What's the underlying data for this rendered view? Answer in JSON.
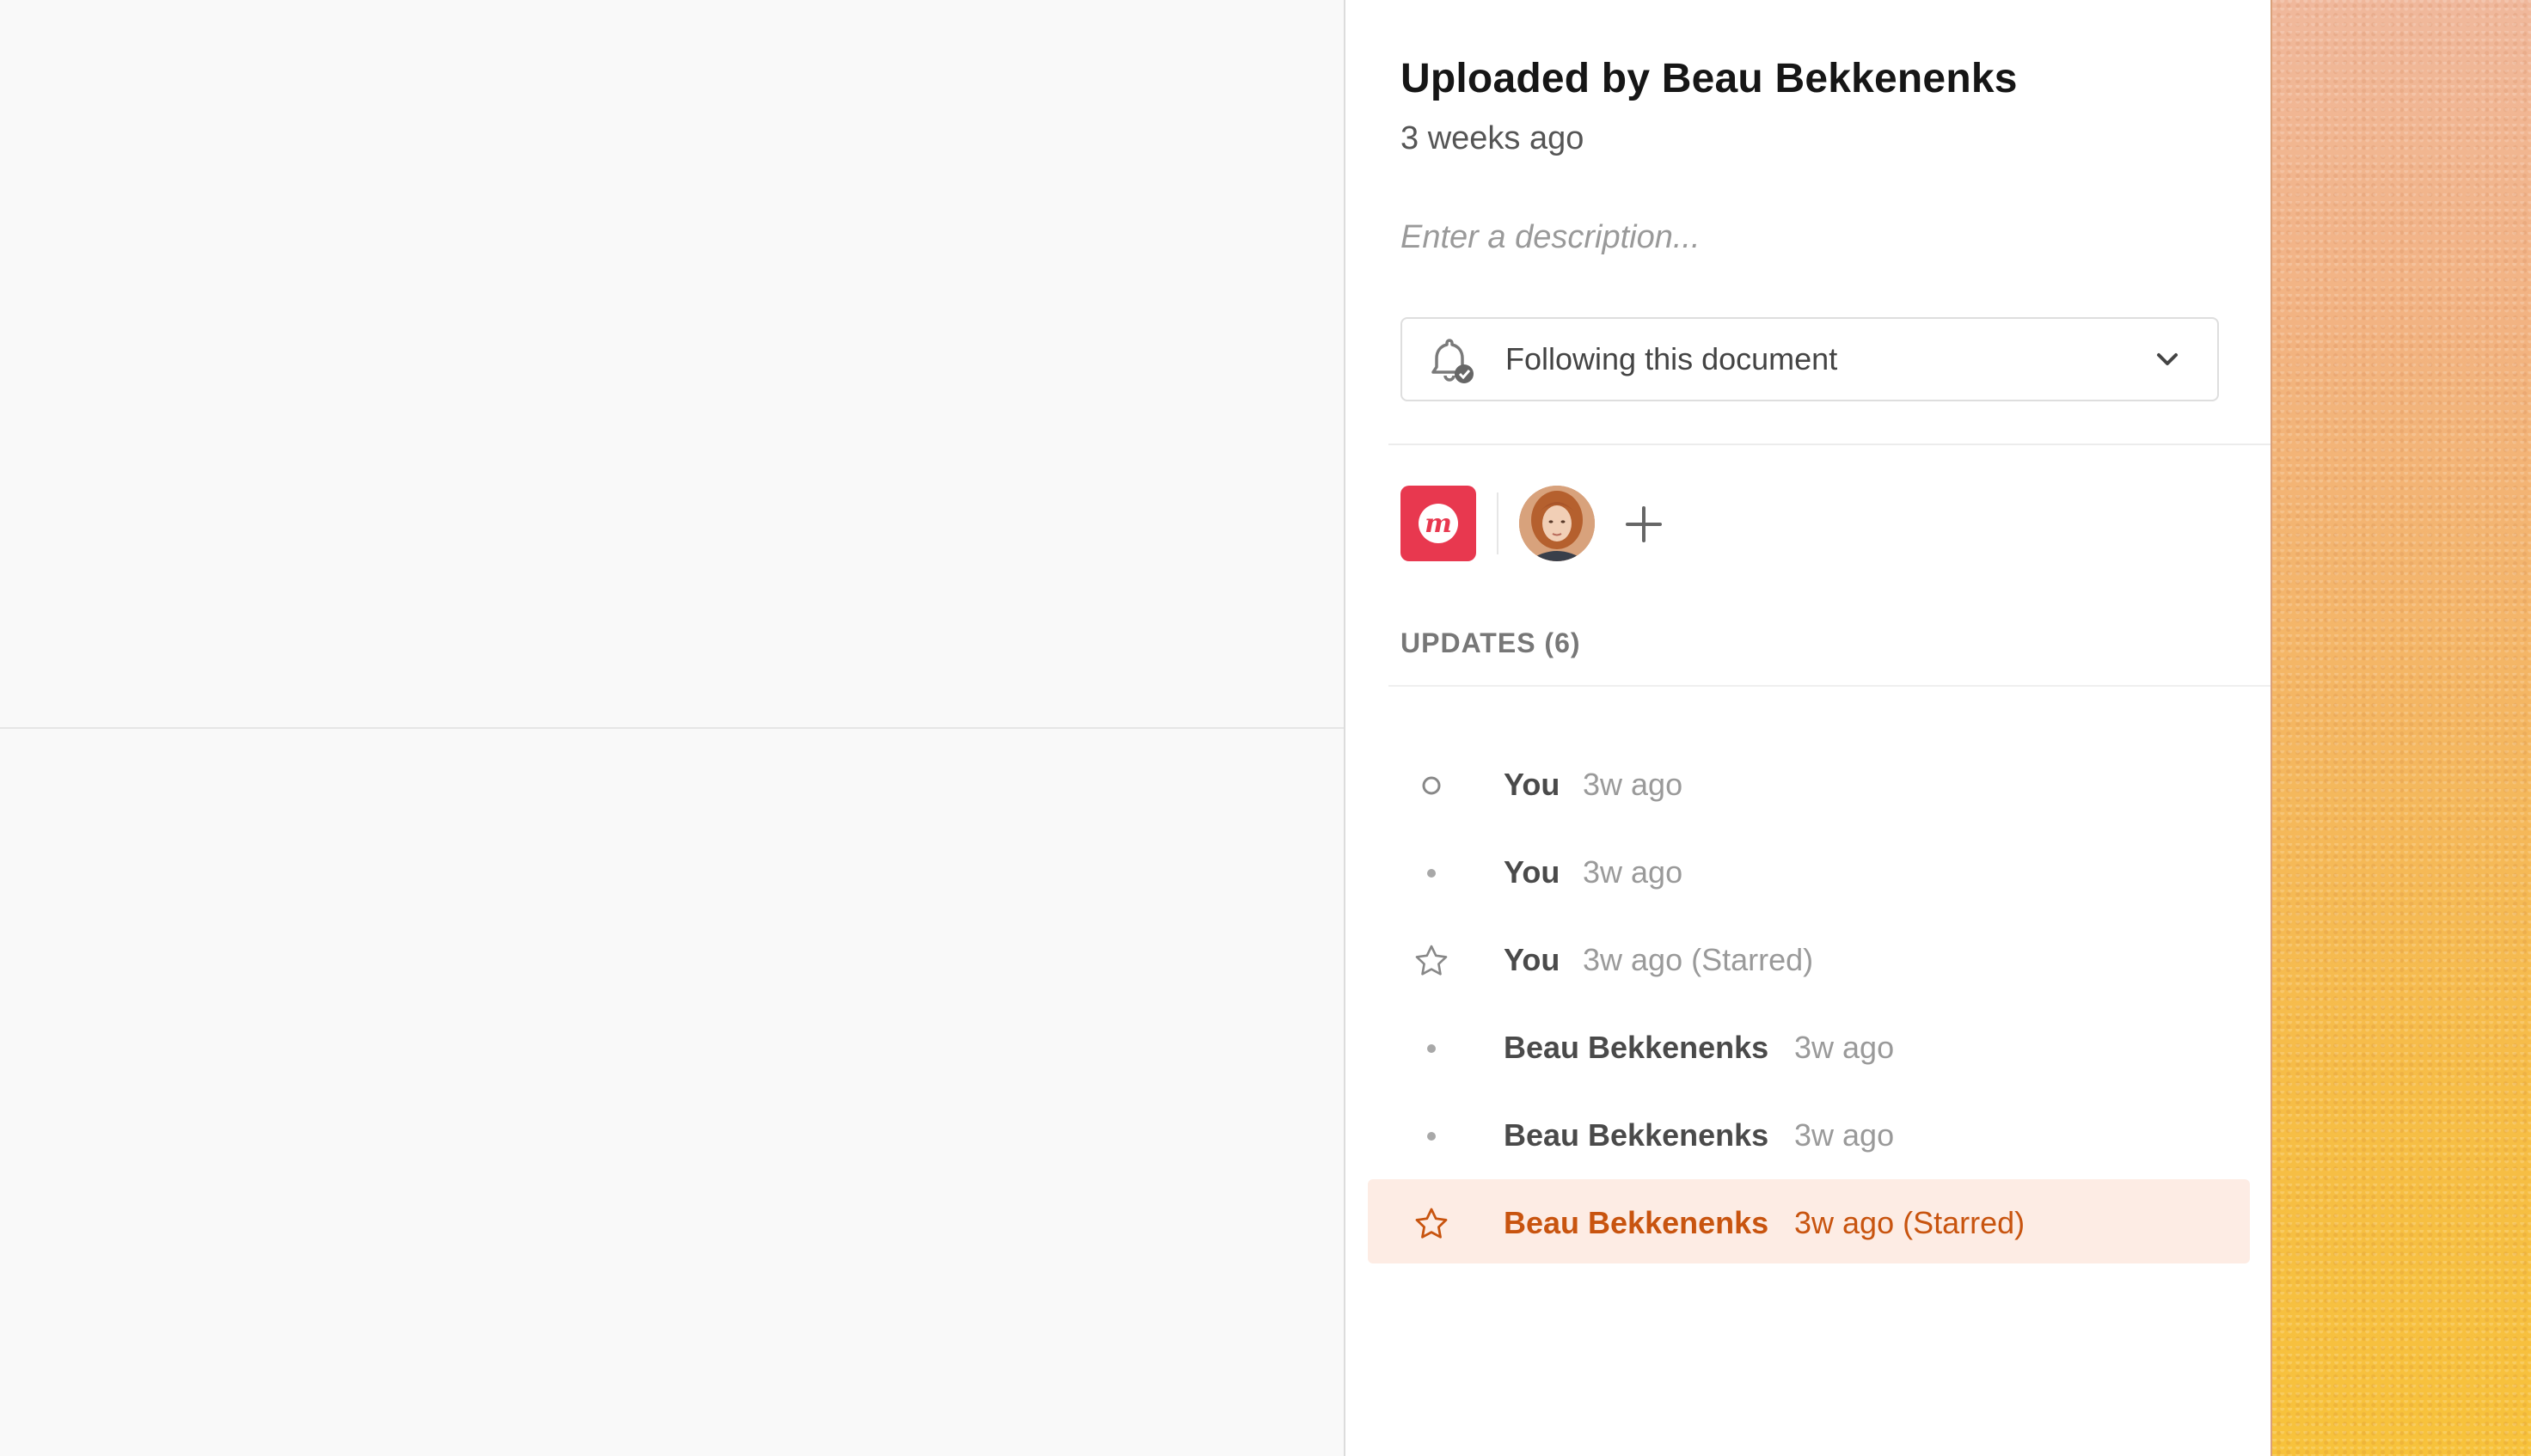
{
  "panel": {
    "title": "Uploaded by Beau Bekkenenks",
    "subtitle": "3 weeks ago",
    "description_placeholder": "Enter a description...",
    "follow": {
      "label": "Following this document",
      "icon": "bell-check-icon"
    }
  },
  "members": {
    "brand_letter": "m",
    "brand_color": "#e8384f"
  },
  "updates": {
    "header": "UPDATES (6)",
    "items": [
      {
        "who": "You",
        "when": "3w ago",
        "icon": "circle-outline-icon"
      },
      {
        "who": "You",
        "when": "3w ago",
        "icon": "dot-icon"
      },
      {
        "who": "You",
        "when": "3w ago (Starred)",
        "icon": "star-icon"
      },
      {
        "who": "Beau Bekkenenks",
        "when": "3w ago",
        "icon": "dot-icon"
      },
      {
        "who": "Beau Bekkenenks",
        "when": "3w ago",
        "icon": "dot-icon"
      },
      {
        "who": "Beau Bekkenenks",
        "when": "3w ago (Starred)",
        "icon": "star-icon"
      }
    ]
  },
  "colors": {
    "active_text": "#c8540f",
    "active_bg": "#fdece4"
  }
}
